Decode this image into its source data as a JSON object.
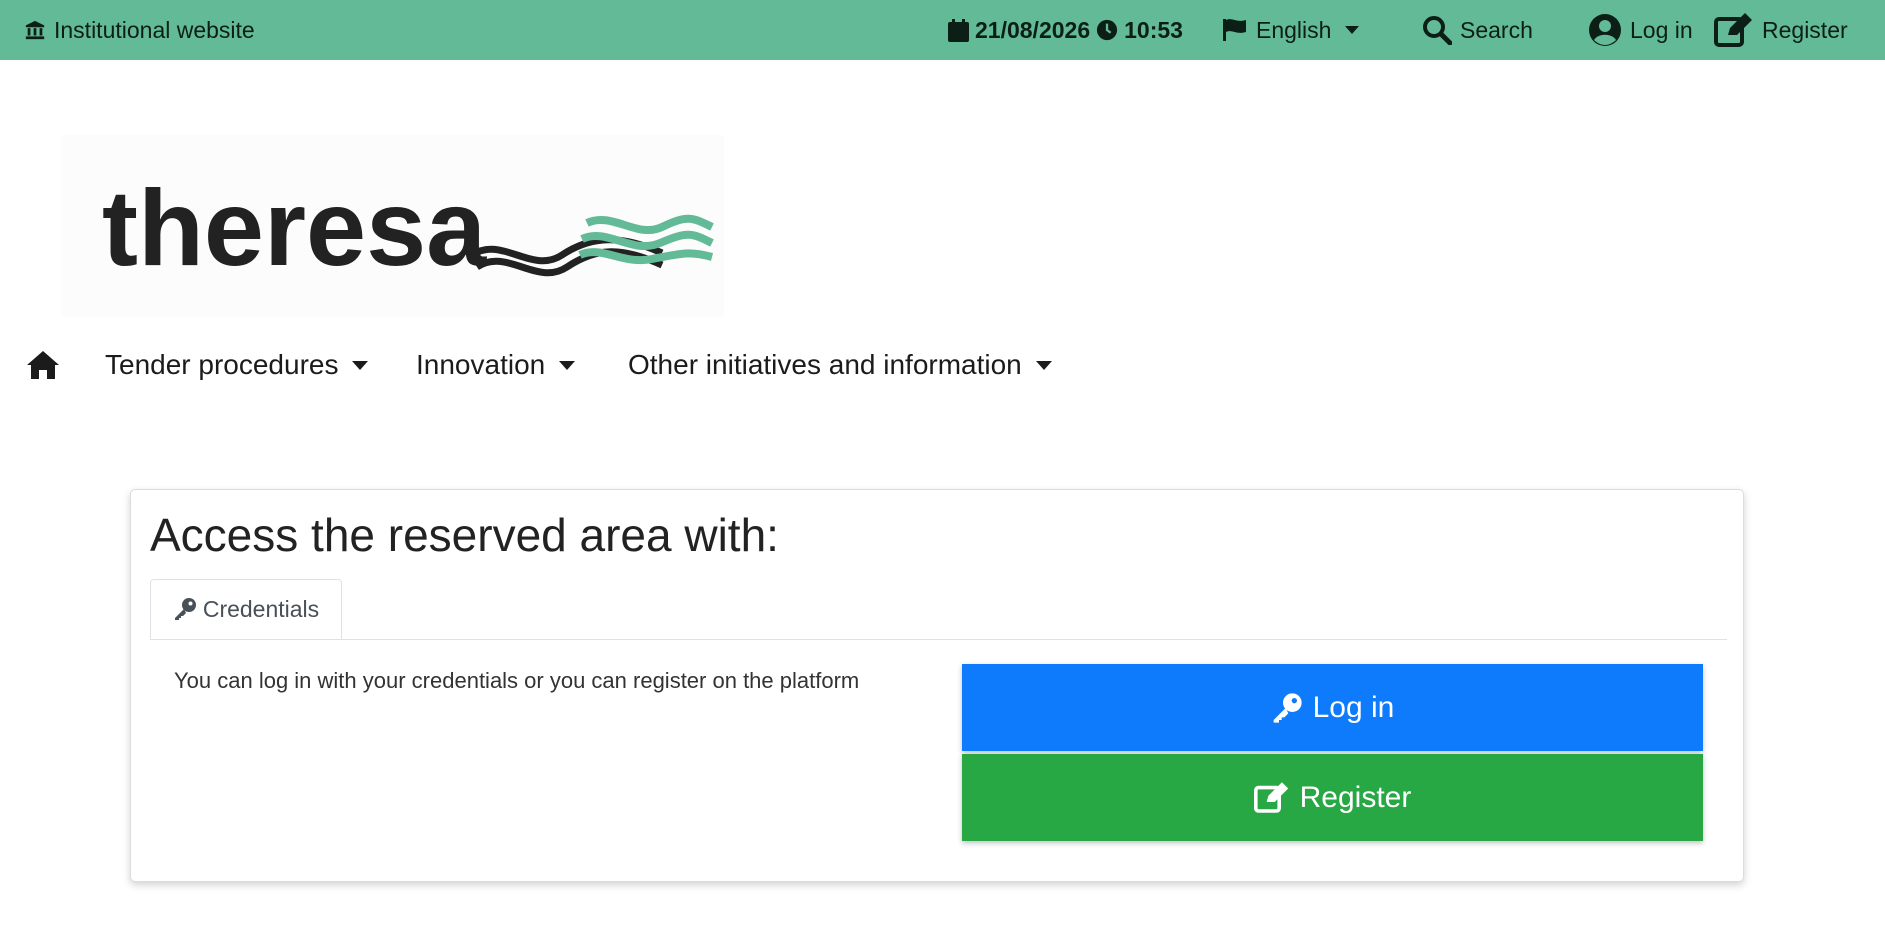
{
  "colors": {
    "topbar_bg": "#63ba97",
    "login_btn": "#0d7bfb",
    "register_btn": "#28a745",
    "logo_wave_accent": "#63ba97"
  },
  "topbar": {
    "institutional": {
      "label": "Institutional website",
      "icon": "bank-icon"
    },
    "date": {
      "value": "21/08/2026",
      "icon": "calendar-icon"
    },
    "time": {
      "value": "10:53",
      "icon": "clock-icon"
    },
    "language": {
      "label": "English",
      "icon": "flag-icon"
    },
    "search": {
      "label": "Search",
      "icon": "search-icon"
    },
    "login": {
      "label": "Log in",
      "icon": "user-circle-icon"
    },
    "register": {
      "label": "Register",
      "icon": "edit-icon"
    }
  },
  "logo": {
    "text": "theresa"
  },
  "nav": {
    "home_icon": "home-icon",
    "items": [
      {
        "label": "Tender procedures"
      },
      {
        "label": "Innovation"
      },
      {
        "label": "Other initiatives and information"
      }
    ]
  },
  "access": {
    "title": "Access the reserved area with:",
    "tab": {
      "label": "Credentials",
      "icon": "key-icon"
    },
    "text": "You can log in with your credentials or you can register on the platform",
    "login_button": {
      "label": "Log in",
      "icon": "key-icon"
    },
    "register_button": {
      "label": "Register",
      "icon": "edit-icon"
    }
  }
}
